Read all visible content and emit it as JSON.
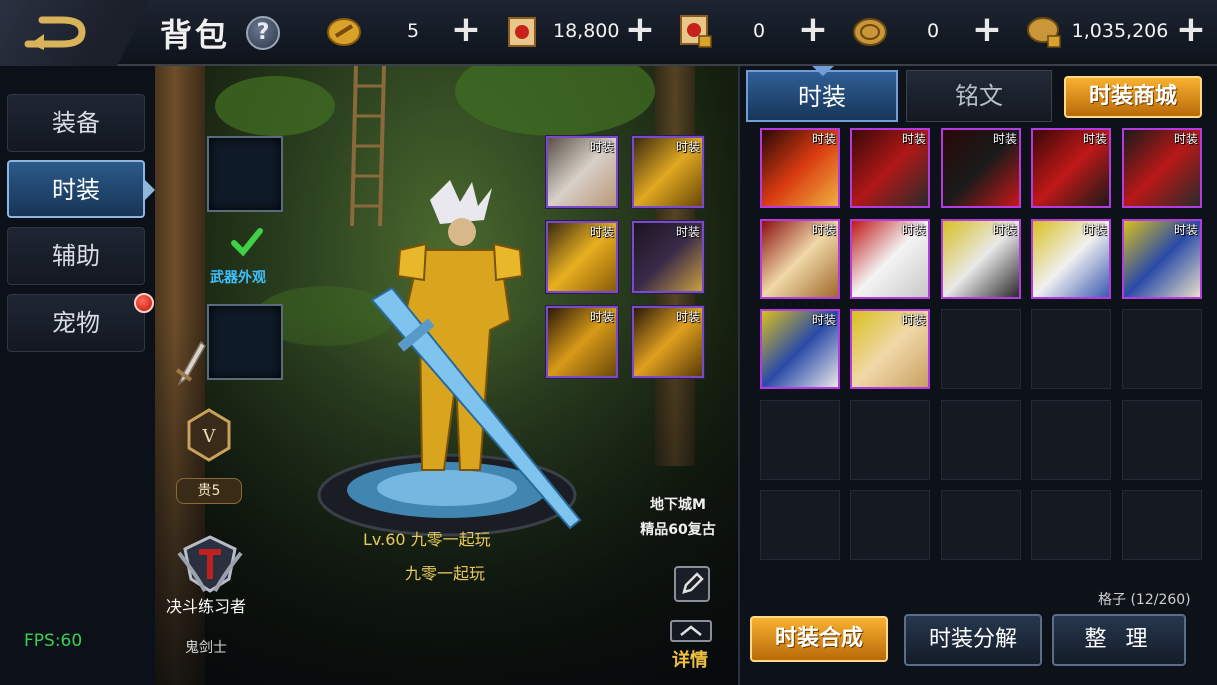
{
  "header": {
    "title": "背包",
    "help": "?",
    "currencies": [
      {
        "icon": "gold-token-icon",
        "value": "5"
      },
      {
        "icon": "red-scroll-icon",
        "value": "18,800"
      },
      {
        "icon": "locked-scroll-icon",
        "value": "0"
      },
      {
        "icon": "bronze-coin-icon",
        "value": "0"
      },
      {
        "icon": "locked-coin-icon",
        "value": "1,035,206"
      }
    ],
    "plus": "+"
  },
  "nav": {
    "items": [
      {
        "label": "装备",
        "active": false
      },
      {
        "label": "时装",
        "active": true
      },
      {
        "label": "辅助",
        "active": false
      },
      {
        "label": "宠物",
        "active": false,
        "badge": "red-dot"
      }
    ]
  },
  "character": {
    "weapon_appearance_label": "武器外观",
    "vip_label": "贵5",
    "vip_letter": "V",
    "rank_label": "决斗练习者",
    "class_label": "鬼剑士",
    "level_line": "Lv.60  九零一起玩",
    "name": "九零一起玩",
    "server_line1": "地下城M",
    "server_line2": "精品60复古",
    "detail_label": "详情"
  },
  "equipped": [
    {
      "tag": "时装",
      "item": "white-hair"
    },
    {
      "tag": "时装",
      "item": "gold-helmet"
    },
    {
      "tag": "时装",
      "item": "gold-shoulder"
    },
    {
      "tag": "时装",
      "item": "dark-pants"
    },
    {
      "tag": "时装",
      "item": "gold-coat"
    },
    {
      "tag": "时装",
      "item": "gold-boots"
    }
  ],
  "tabs": {
    "fashion": "时装",
    "inscription": "铭文",
    "shop": "时装商城"
  },
  "inventory": {
    "tag": "时装",
    "filled": [
      "red-flame-coat",
      "red-boots",
      "red-pants",
      "red-gloves",
      "red-armor",
      "blonde-hair",
      "white-wings",
      "white-armor",
      "white-robe",
      "blue-robe",
      "blue-armor",
      "blonde-face"
    ],
    "total_slots": 25,
    "count_label": "格子 (12/260)"
  },
  "actions": {
    "synth": "时装合成",
    "decompose": "时装分解",
    "sort": "整 理"
  },
  "fps": "FPS:60"
}
